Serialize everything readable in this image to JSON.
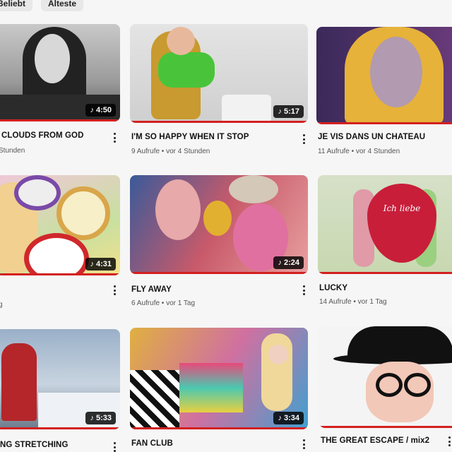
{
  "filters": {
    "popular": "Beliebt",
    "oldest": "Älteste"
  },
  "videos": [
    {
      "title": "CLOUDS FROM GOD",
      "meta": "Stunden",
      "duration": "4:50"
    },
    {
      "title": "I'M SO HAPPY WHEN IT STOP",
      "meta": "9 Aufrufe • vor 4 Stunden",
      "duration": "5:17"
    },
    {
      "title": "JE VIS DANS UN CHATEAU",
      "meta": "11 Aufrufe • vor 4 Stunden",
      "duration": ""
    },
    {
      "title": "",
      "meta": "g",
      "duration": "4:31"
    },
    {
      "title": "FLY AWAY",
      "meta": "6 Aufrufe • vor 1 Tag",
      "duration": "2:24"
    },
    {
      "title": "LUCKY",
      "meta": "14 Aufrufe • vor 1 Tag",
      "duration": "",
      "thumb_text": "Ich liebe"
    },
    {
      "title": "NG STRETCHING",
      "meta": "",
      "duration": "5:33"
    },
    {
      "title": "FAN CLUB",
      "meta": "",
      "duration": "3:34"
    },
    {
      "title": "THE GREAT ESCAPE / mix2",
      "meta": "",
      "duration": ""
    }
  ],
  "colors": {
    "progress": "#d32020",
    "badge": "#000000"
  },
  "icons": {
    "duration": "music-note-icon",
    "menu": "more-vert-icon"
  }
}
